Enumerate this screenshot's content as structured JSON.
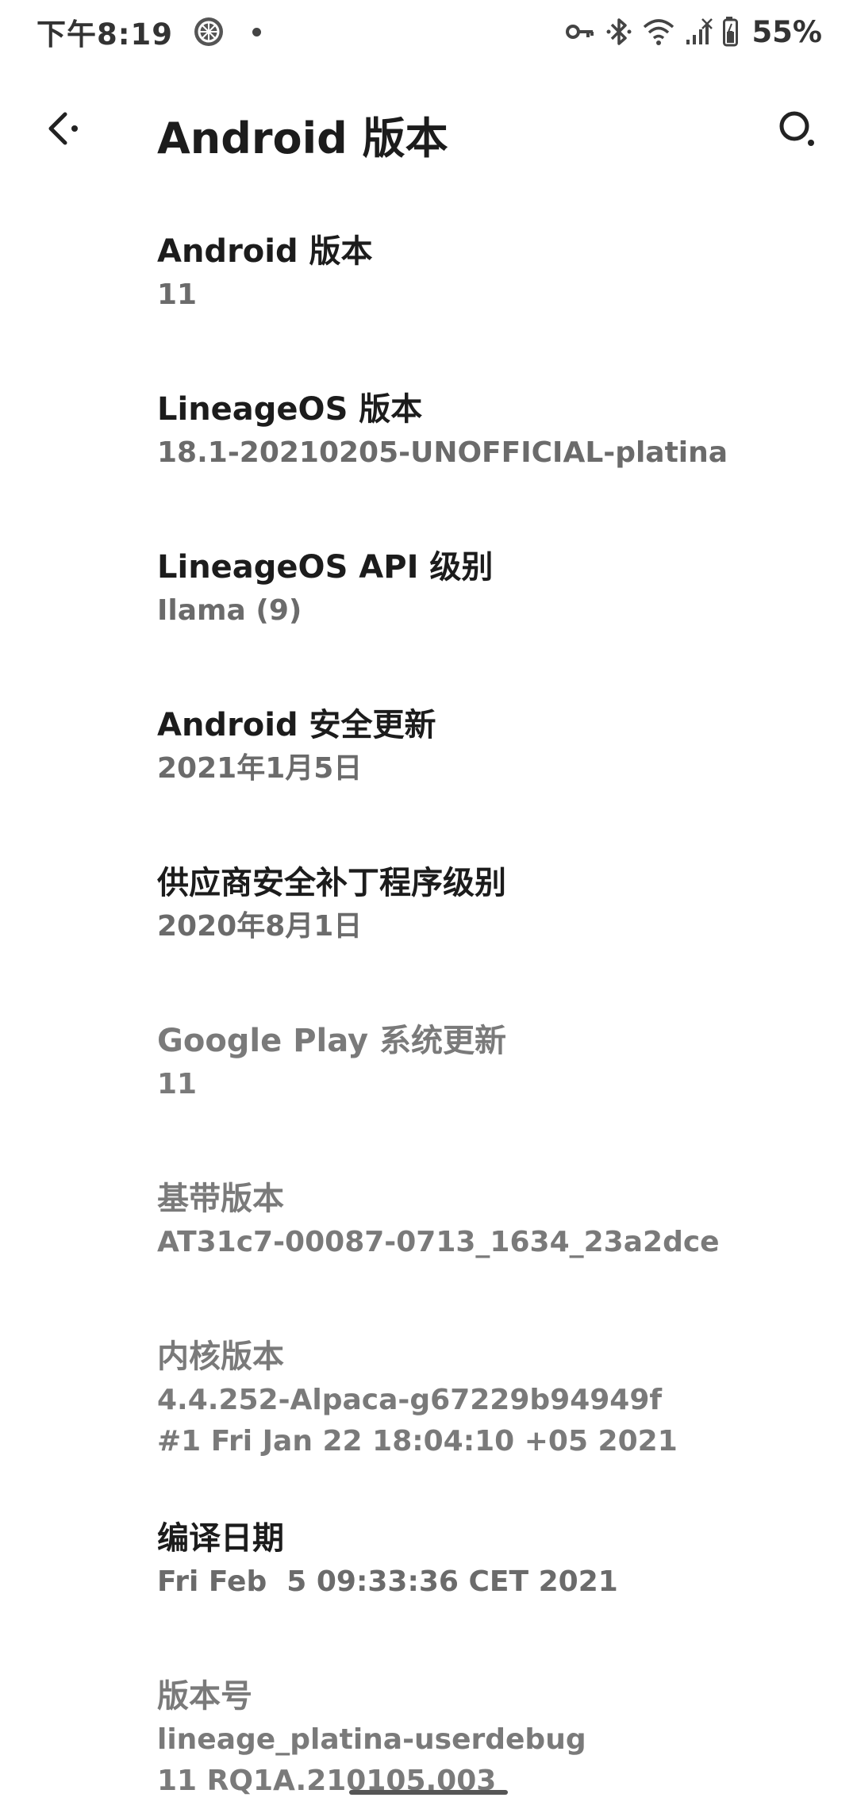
{
  "status_bar": {
    "time": "下午8:19",
    "battery_percent": "55%",
    "icons": [
      "app-notification-icon",
      "dot-icon",
      "vpn-key-icon",
      "bluetooth-icon",
      "wifi-icon",
      "cellular-signal-icon",
      "battery-icon"
    ]
  },
  "app_bar": {
    "title": "Android 版本",
    "back_icon": "back-arrow-icon",
    "search_icon": "search-icon"
  },
  "items": [
    {
      "title": "Android 版本",
      "summary": "11",
      "enabled": true
    },
    {
      "title": "LineageOS 版本",
      "summary": "18.1-20210205-UNOFFICIAL-platina",
      "enabled": true
    },
    {
      "title": "LineageOS API 级别",
      "summary": "Ilama (9)",
      "enabled": true
    },
    {
      "title": "Android 安全更新",
      "summary": "2021年1月5日",
      "enabled": true
    },
    {
      "title": "供应商安全补丁程序级别",
      "summary": "2020年8月1日",
      "enabled": true
    },
    {
      "title": "Google Play 系统更新",
      "summary": "11",
      "enabled": false
    },
    {
      "title": "基带版本",
      "summary": "AT31c7-00087-0713_1634_23a2dce",
      "enabled": false
    },
    {
      "title": "内核版本",
      "summary": "4.4.252-Alpaca-g67229b94949f\n#1 Fri Jan 22 18:04:10 +05 2021",
      "enabled": false
    },
    {
      "title": "编译日期",
      "summary": "Fri Feb  5 09:33:36 CET 2021",
      "enabled": true
    },
    {
      "title": "版本号",
      "summary": "lineage_platina-userdebug\n11 RQ1A.210105.003",
      "enabled": false
    }
  ],
  "colors": {
    "background": "#ffffff",
    "title_text": "#1c1c1c",
    "summary_text": "#6b6b6b",
    "disabled_text": "#7a7a7a"
  }
}
